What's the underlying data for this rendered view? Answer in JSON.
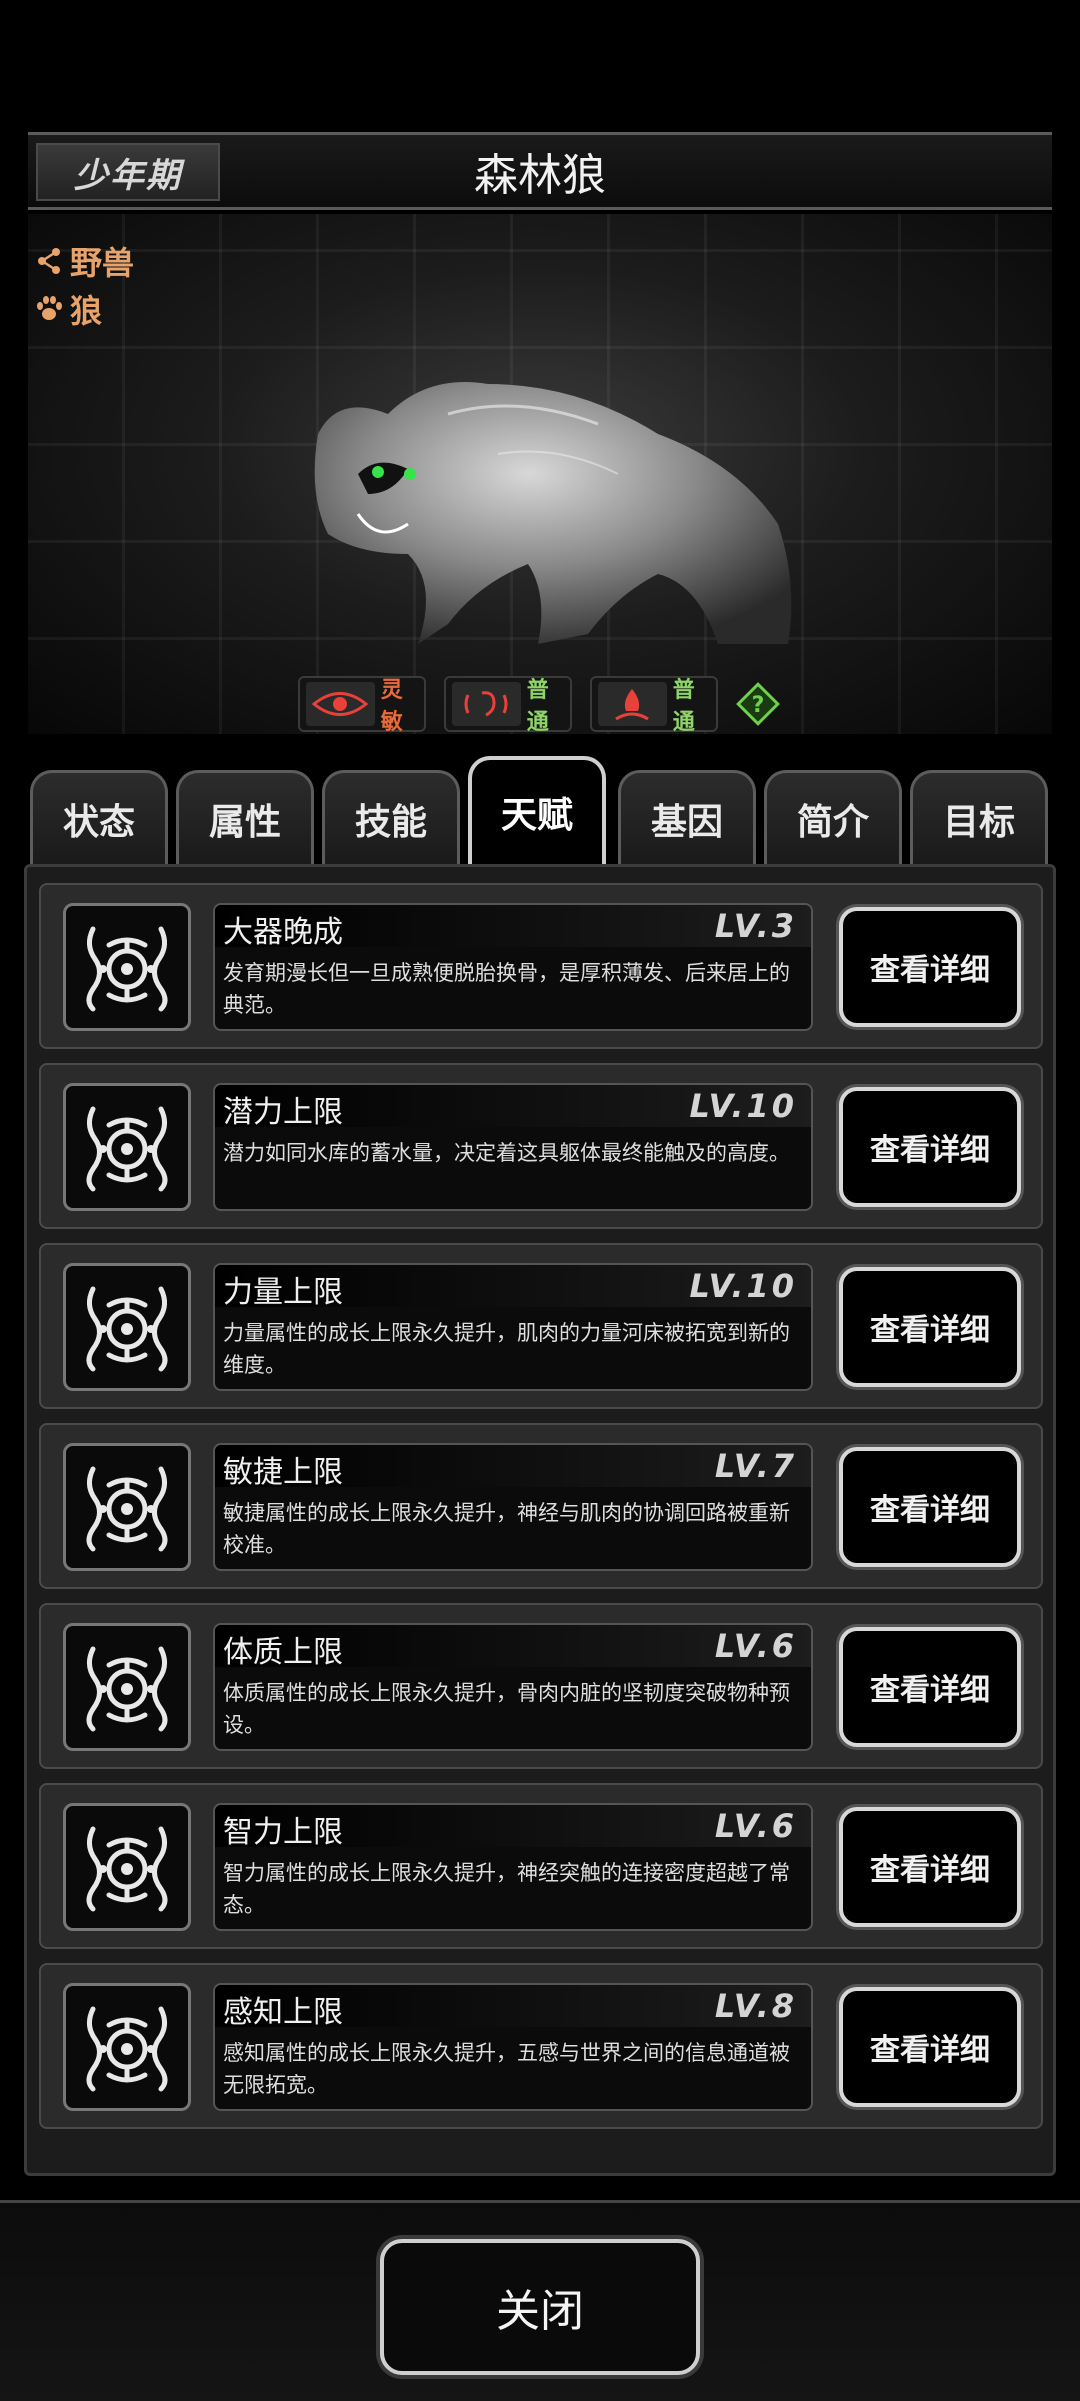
{
  "header": {
    "stage": "少年期",
    "title": "森林狼"
  },
  "tags": [
    {
      "icon": "share-icon",
      "label": "野兽"
    },
    {
      "icon": "paw-icon",
      "label": "狼"
    }
  ],
  "senses": [
    {
      "icon": "eye-icon",
      "label": "灵敏",
      "color": "#e86a3a"
    },
    {
      "icon": "ear-icon",
      "label": "普通",
      "color": "#8fd36a"
    },
    {
      "icon": "smell-icon",
      "label": "普通",
      "color": "#8fd36a"
    }
  ],
  "tabs": [
    "状态",
    "属性",
    "技能",
    "天赋",
    "基因",
    "简介",
    "目标"
  ],
  "active_tab": "天赋",
  "talents": [
    {
      "name": "大器晚成",
      "level": "LV.3",
      "desc": "发育期漫长但一旦成熟便脱胎换骨，是厚积薄发、后来居上的典范。",
      "button": "查看详细"
    },
    {
      "name": "潜力上限",
      "level": "LV.10",
      "desc": "潜力如同水库的蓄水量，决定着这具躯体最终能触及的高度。",
      "button": "查看详细"
    },
    {
      "name": "力量上限",
      "level": "LV.10",
      "desc": "力量属性的成长上限永久提升，肌肉的力量河床被拓宽到新的维度。",
      "button": "查看详细"
    },
    {
      "name": "敏捷上限",
      "level": "LV.7",
      "desc": "敏捷属性的成长上限永久提升，神经与肌肉的协调回路被重新校准。",
      "button": "查看详细"
    },
    {
      "name": "体质上限",
      "level": "LV.6",
      "desc": "体质属性的成长上限永久提升，骨肉内脏的坚韧度突破物种预设。",
      "button": "查看详细"
    },
    {
      "name": "智力上限",
      "level": "LV.6",
      "desc": "智力属性的成长上限永久提升，神经突触的连接密度超越了常态。",
      "button": "查看详细"
    },
    {
      "name": "感知上限",
      "level": "LV.8",
      "desc": "感知属性的成长上限永久提升，五感与世界之间的信息通道被无限拓宽。",
      "button": "查看详细"
    }
  ],
  "close_label": "关闭"
}
